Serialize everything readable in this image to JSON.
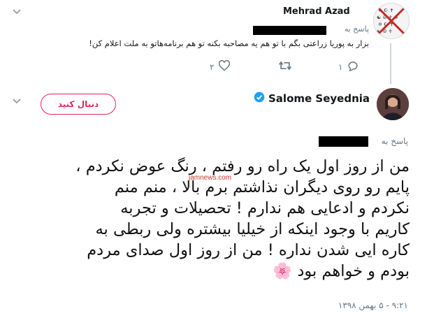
{
  "reply_tweet": {
    "author_name": "Mehrad Azad",
    "replying_to_label": "پاسخ به",
    "text": "بزار به پوریا زراعتی بگم با تو هم یه مصاحبه بکنه تو هم برنامه‌هاتو به ملت اعلام کن!",
    "actions": {
      "reply_icon": "reply-icon",
      "retweet_icon": "retweet-icon",
      "like_icon": "heart-icon",
      "reply_count": "۱",
      "like_count": "۲"
    }
  },
  "main_tweet": {
    "author_name": "Salome Seyednia",
    "verified_icon": "verified-badge-icon",
    "follow_button_label": "دنبال کنید",
    "replying_to_label": "پاسخ به",
    "body_lines": [
      "من از روز اول یک راه رو رفتم ، رنگ عوض نکردم ،",
      "پایم رو روی دیگران نذاشتم برم بالا ، منم منم",
      "نکردم و ادعایی هم ندارم ! تحصیلات و تجربه",
      "کاریم با وجود اینکه از خیلیا بیشتره ولی ربطی به",
      "کاره ایی شدن نداره ! من از روز اول صدای مردم",
      "بودم و خواهم بود"
    ],
    "emoji": "🌸",
    "timestamp": "۹:۲۱ - ۵ بهمن ۱۳۹۸"
  },
  "watermark": "jamnews.com",
  "colors": {
    "accent_pink": "#e0245e",
    "verified_blue": "#1da1f2",
    "secondary_text": "#657786"
  }
}
